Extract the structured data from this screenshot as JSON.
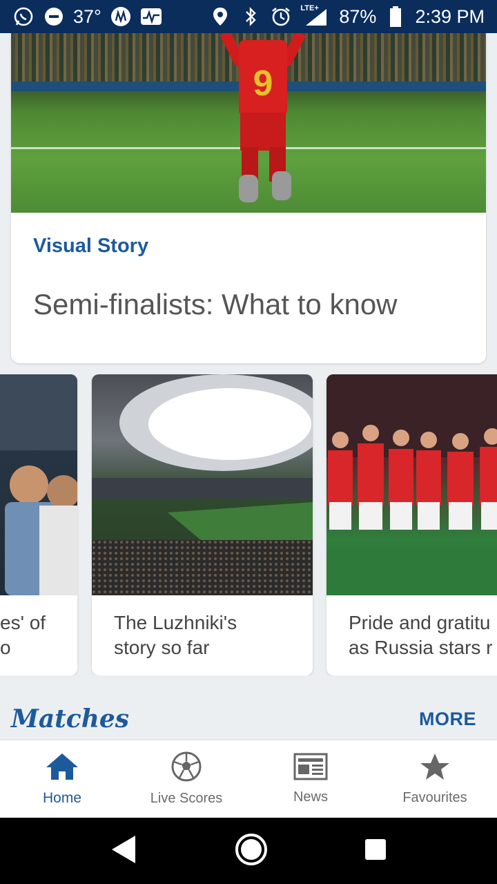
{
  "status_bar": {
    "temperature": "37°",
    "network": "LTE+",
    "battery": "87%",
    "time": "2:39 PM",
    "left_icons": [
      "whatsapp-icon",
      "do-not-disturb-icon",
      "app-icon",
      "activity-icon"
    ],
    "right_icons": [
      "location-icon",
      "bluetooth-icon",
      "alarm-icon",
      "signal-icon",
      "battery-icon"
    ]
  },
  "hero": {
    "image": "belgium-player-kneeling-photo",
    "tag": "Visual Story",
    "title": "Semi-finalists: What to know"
  },
  "carousel": {
    "items": [
      {
        "image": "italy-players-photo",
        "caption_line1": "es' of",
        "caption_line2": "o"
      },
      {
        "image": "luzhniki-stadium-photo",
        "caption_line1": "The Luzhniki's",
        "caption_line2": "story so far"
      },
      {
        "image": "russia-players-photo",
        "caption_line1": "Pride and gratitu",
        "caption_line2": "as Russia stars r"
      }
    ]
  },
  "matches": {
    "title": "Matches",
    "more_label": "MORE"
  },
  "bottom_nav": {
    "items": [
      {
        "label": "Home",
        "icon": "home-icon",
        "active": true
      },
      {
        "label": "Live Scores",
        "icon": "soccer-ball-icon",
        "active": false
      },
      {
        "label": "News",
        "icon": "newspaper-icon",
        "active": false
      },
      {
        "label": "Favourites",
        "icon": "star-icon",
        "active": false
      }
    ]
  },
  "colors": {
    "brand": "#1c5a9c",
    "status_bar": "#0b2d5c",
    "background": "#eceff1"
  }
}
